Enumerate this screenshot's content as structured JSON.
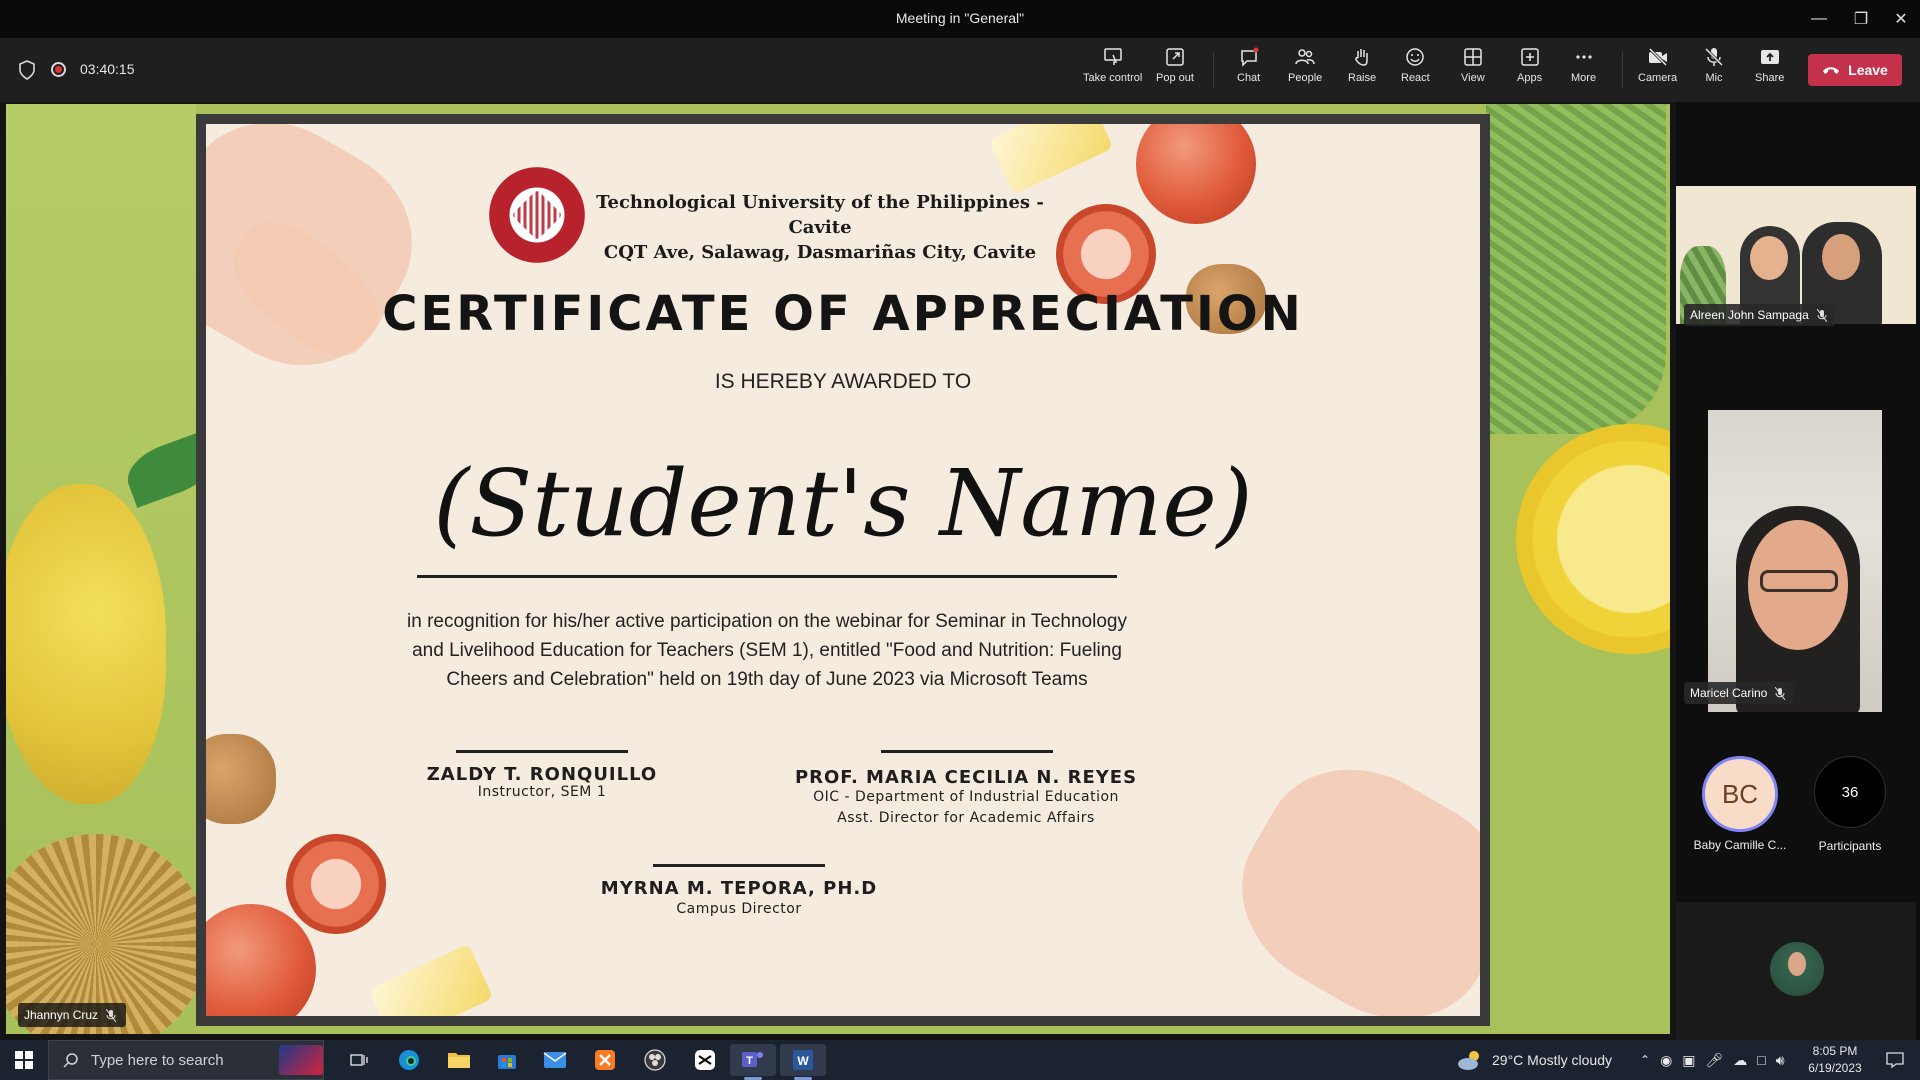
{
  "window": {
    "title": "Meeting in \"General\""
  },
  "meeting": {
    "timer": "03:40:15",
    "toolbar": [
      {
        "id": "take_control",
        "label": "Take control",
        "icon": "take-control-icon"
      },
      {
        "id": "pop_out",
        "label": "Pop out",
        "icon": "pop-out-icon"
      },
      {
        "id": "chat",
        "label": "Chat",
        "icon": "chat-icon"
      },
      {
        "id": "people",
        "label": "People",
        "icon": "people-icon"
      },
      {
        "id": "raise",
        "label": "Raise",
        "icon": "raise-hand-icon"
      },
      {
        "id": "react",
        "label": "React",
        "icon": "react-icon"
      },
      {
        "id": "view",
        "label": "View",
        "icon": "view-icon"
      },
      {
        "id": "apps",
        "label": "Apps",
        "icon": "apps-icon"
      },
      {
        "id": "more",
        "label": "More",
        "icon": "more-icon"
      },
      {
        "id": "camera",
        "label": "Camera",
        "icon": "camera-off-icon"
      },
      {
        "id": "mic",
        "label": "Mic",
        "icon": "mic-off-icon"
      },
      {
        "id": "share",
        "label": "Share",
        "icon": "share-icon"
      }
    ],
    "leave_label": "Leave",
    "leave_color": "#c4314b",
    "presenter_name": "Jhannyn Cruz"
  },
  "certificate": {
    "university": "Technological University of the Philippines - Cavite",
    "address": "CQT Ave, Salawag, Dasmariñas City, Cavite",
    "title": "CERTIFICATE OF APPRECIATION",
    "awarded": "IS HEREBY AWARDED TO",
    "student_name": "(Student's Name)",
    "recognition_lines": [
      "in recognition for his/her active participation on the webinar for Seminar in Technology",
      "and Livelihood Education for Teachers (SEM 1), entitled \"Food and Nutrition: Fueling",
      "Cheers and Celebration\" held on 19th day of June 2023 via Microsoft Teams"
    ],
    "signatories": {
      "left": {
        "name": "ZALDY T. RONQUILLO",
        "role": "Instructor, SEM 1"
      },
      "right": {
        "name": "PROF. MARIA CECILIA N. REYES",
        "role_1": "OIC - Department of Industrial Education",
        "role_2": "Asst. Director for Academic Affairs"
      },
      "center": {
        "name": "MYRNA M. TEPORA, PH.D",
        "role": "Campus Director"
      }
    }
  },
  "participants": {
    "tile1_name": "Alreen John Sampaga",
    "tile2_name": "Maricel Carino",
    "avatar_initials": "BC",
    "avatar_name": "Baby Camille C...",
    "count": "36",
    "count_label": "Participants"
  },
  "taskbar": {
    "search_placeholder": "Type here to search",
    "weather": "29°C  Mostly cloudy",
    "time": "8:05 PM",
    "date": "6/19/2023"
  }
}
